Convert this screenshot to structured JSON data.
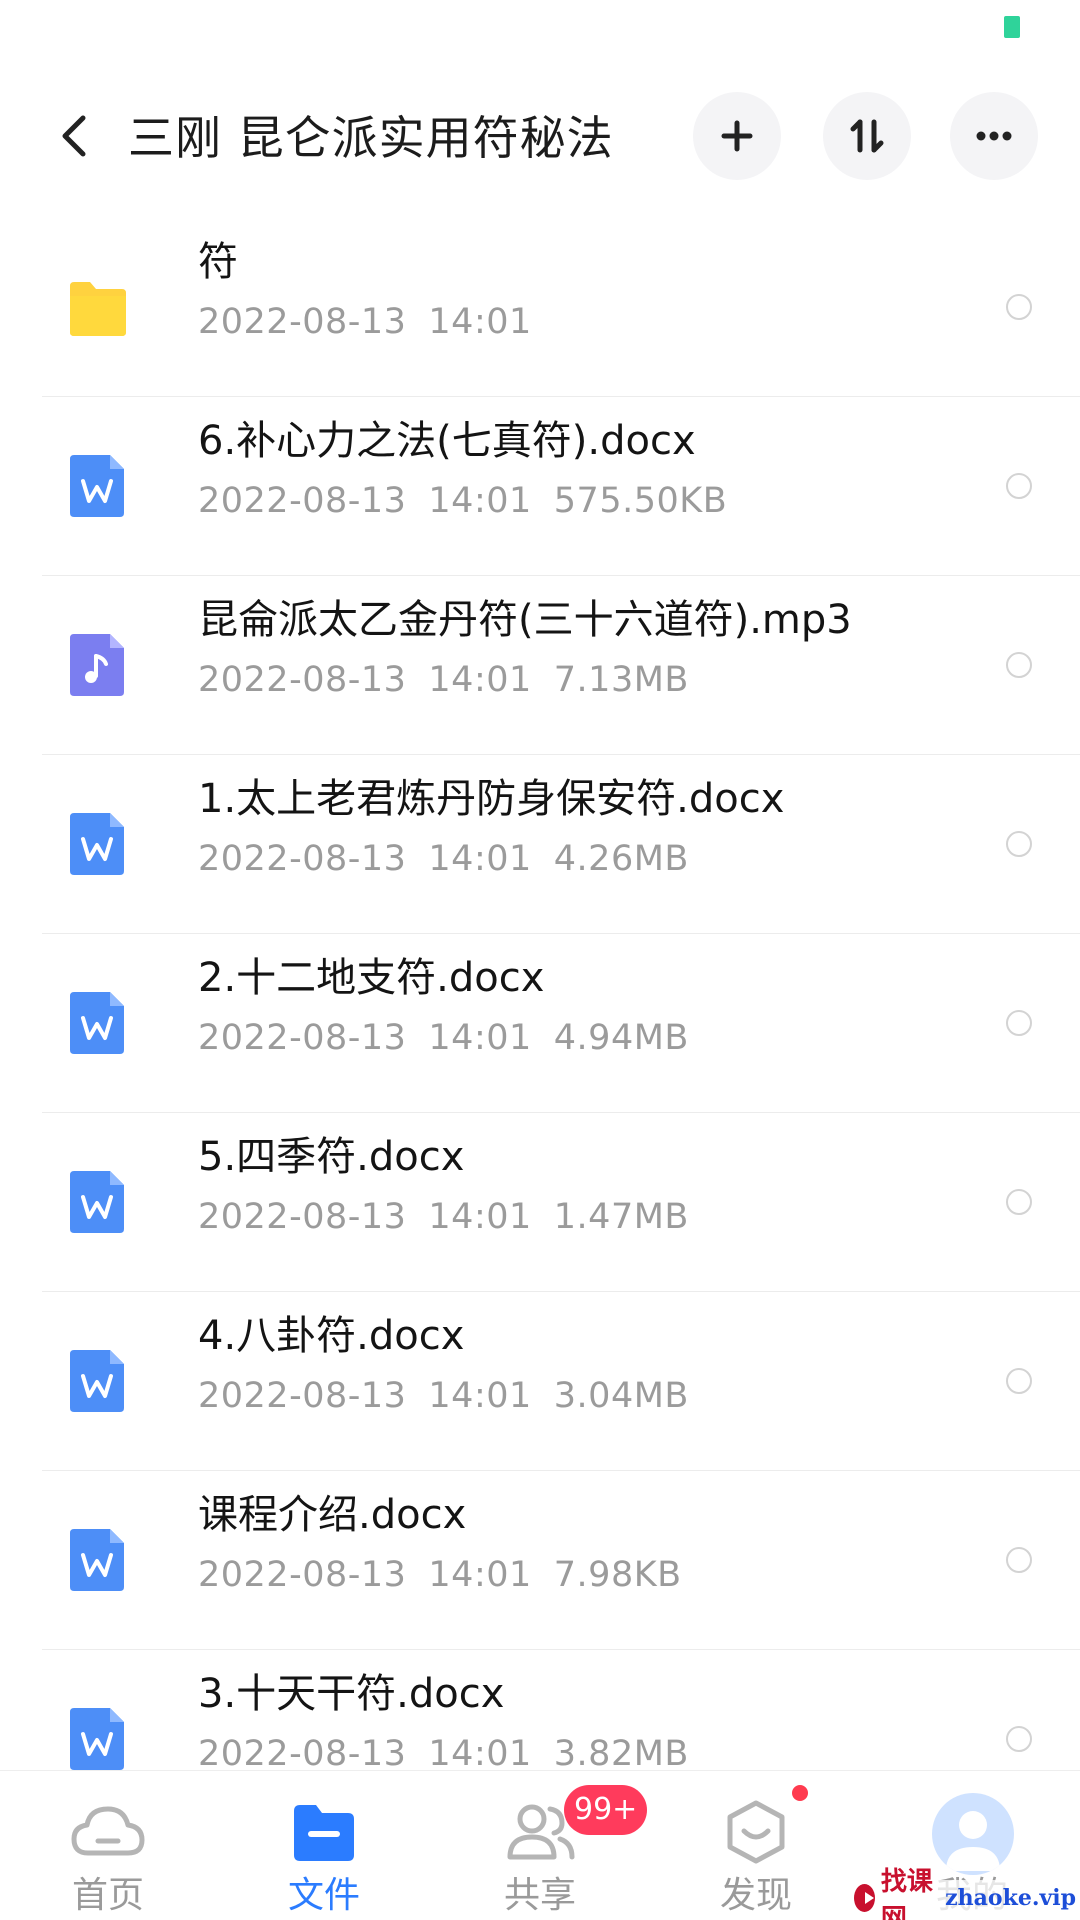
{
  "colors": {
    "accent": "#2b7cff",
    "folder": "#ffd23f",
    "doc": "#4d8ef7",
    "audio": "#7b7ef0",
    "badge": "#ff3b5c",
    "meta_text": "#9b9b9b"
  },
  "header": {
    "title": "三刚 昆仑派实用符秘法",
    "back_icon": "chevron-left-icon",
    "actions": [
      "plus-icon",
      "sort-icon",
      "more-icon"
    ]
  },
  "files": [
    {
      "name": "符",
      "date": "2022-08-13",
      "time": "14:01",
      "size": "",
      "type": "folder"
    },
    {
      "name": "6.补心力之法(七真符).docx",
      "date": "2022-08-13",
      "time": "14:01",
      "size": "575.50KB",
      "type": "doc"
    },
    {
      "name": "昆侖派太乙金丹符(三十六道符).mp3",
      "date": "2022-08-13",
      "time": "14:01",
      "size": "7.13MB",
      "type": "audio"
    },
    {
      "name": "1.太上老君炼丹防身保安符.docx",
      "date": "2022-08-13",
      "time": "14:01",
      "size": "4.26MB",
      "type": "doc"
    },
    {
      "name": "2.十二地支符.docx",
      "date": "2022-08-13",
      "time": "14:01",
      "size": "4.94MB",
      "type": "doc"
    },
    {
      "name": "5.四季符.docx",
      "date": "2022-08-13",
      "time": "14:01",
      "size": "1.47MB",
      "type": "doc"
    },
    {
      "name": "4.八卦符.docx",
      "date": "2022-08-13",
      "time": "14:01",
      "size": "3.04MB",
      "type": "doc"
    },
    {
      "name": "课程介绍.docx",
      "date": "2022-08-13",
      "time": "14:01",
      "size": "7.98KB",
      "type": "doc"
    },
    {
      "name": "3.十天干符.docx",
      "date": "2022-08-13",
      "time": "14:01",
      "size": "3.82MB",
      "type": "doc"
    }
  ],
  "nav": {
    "items": [
      {
        "label": "首页",
        "icon": "cloud-icon",
        "active": false
      },
      {
        "label": "文件",
        "icon": "folder-icon",
        "active": true
      },
      {
        "label": "共享",
        "icon": "people-icon",
        "active": false
      },
      {
        "label": "发现",
        "icon": "discover-icon",
        "active": false
      },
      {
        "label": "我的",
        "icon": "avatar-icon",
        "active": false
      }
    ],
    "share_badge": "99+"
  },
  "watermark": {
    "text": "找课网",
    "domain": "zhaoke.vip"
  }
}
